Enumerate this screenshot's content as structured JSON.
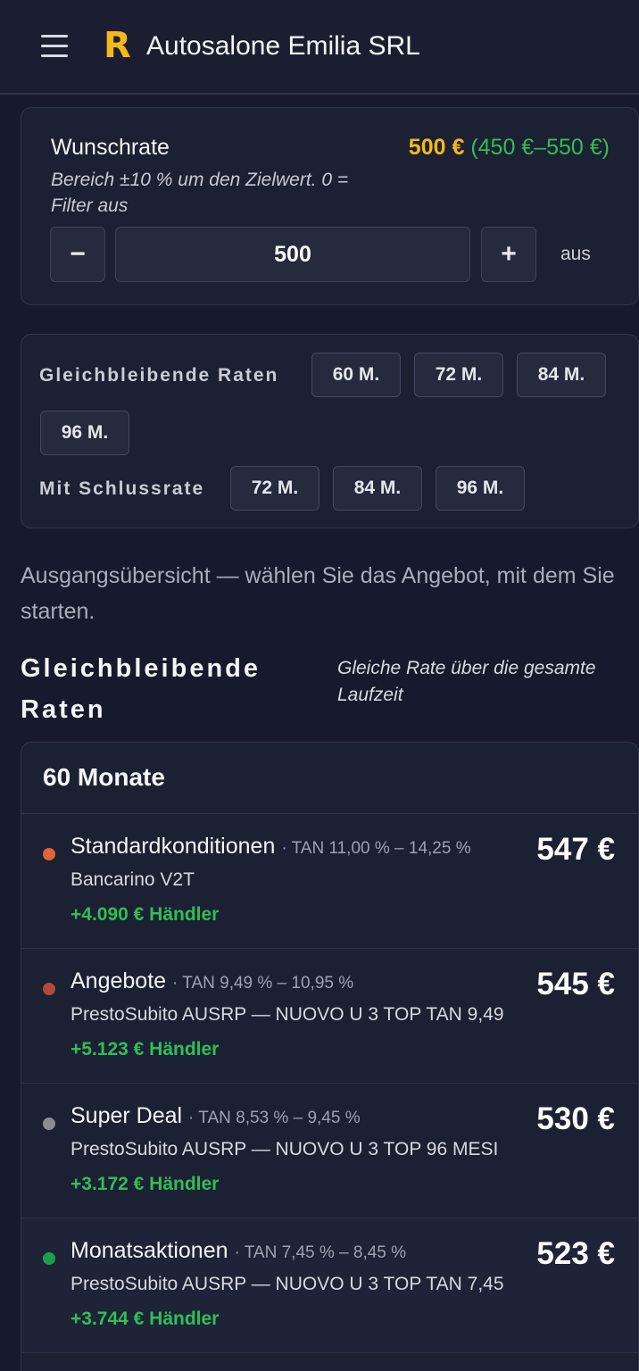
{
  "header": {
    "logo_letter": "R",
    "title": "Autosalone Emilia SRL"
  },
  "wunschrate": {
    "label": "Wunschrate",
    "value_display": "500 €",
    "range_open": "(",
    "range_display": "450 €–550 €",
    "range_close": ")",
    "hint": "Bereich ±10 % um den Zielwert. 0 = Filter aus",
    "minus_label": "−",
    "plus_label": "+",
    "input_value": "500",
    "state_label": "aus"
  },
  "terms": {
    "constant_label": "Gleichbleibende Raten",
    "constant_options": [
      "60 M.",
      "72 M.",
      "84 M.",
      "96 M."
    ],
    "balloon_label": "Mit Schlussrate",
    "balloon_options": [
      "72 M.",
      "84 M.",
      "96 M."
    ]
  },
  "intro": "Ausgangsübersicht — wählen Sie das Angebot, mit dem Sie starten.",
  "section": {
    "title": "Gleichbleibende Raten",
    "subtitle": "Gleiche Rate über die gesamte Laufzeit"
  },
  "offers_card": {
    "title": "60 Monate",
    "offers": [
      {
        "name": "Standardkonditionen",
        "tan": "· TAN 11,00 % – 14,25 %",
        "bank": "Bancarino V2T",
        "gain": "+4.090 € Händler",
        "rate": "547 €",
        "dot_color": "#e0643a"
      },
      {
        "name": "Angebote",
        "tan": "· TAN 9,49 % – 10,95 %",
        "bank": "PrestoSubito AUSRP — NUOVO U 3 TOP TAN 9,49",
        "gain": "+5.123 € Händler",
        "rate": "545 €",
        "dot_color": "#b04a3a"
      },
      {
        "name": "Super Deal",
        "tan": "· TAN 8,53 % – 9,45 %",
        "bank": "PrestoSubito AUSRP — NUOVO U 3 TOP 96 MESI",
        "gain": "+3.172 € Händler",
        "rate": "530 €",
        "dot_color": "#8a8c96"
      },
      {
        "name": "Monatsaktionen",
        "tan": "· TAN 7,45 % – 8,45 %",
        "bank": "PrestoSubito AUSRP — NUOVO U 3 TOP TAN 7,45",
        "gain": "+3.744 € Händler",
        "rate": "523 €",
        "dot_color": "#1e9e4a"
      }
    ]
  }
}
